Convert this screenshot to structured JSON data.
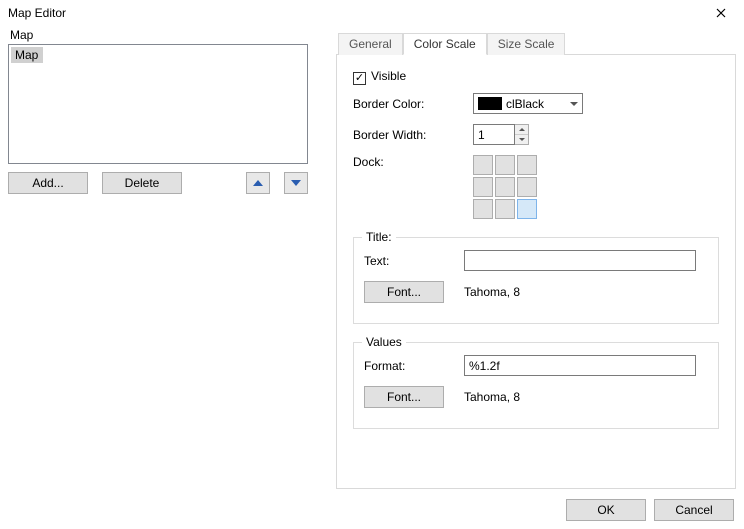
{
  "window": {
    "title": "Map Editor"
  },
  "left": {
    "group_label": "Map",
    "list": {
      "item0": "Map"
    },
    "add_label": "Add...",
    "delete_label": "Delete"
  },
  "tabs": {
    "general": "General",
    "color_scale": "Color Scale",
    "size_scale": "Size Scale"
  },
  "panel": {
    "visible_label": "Visible",
    "visible_checked": true,
    "border_color_label": "Border Color:",
    "border_color_value": "clBlack",
    "border_width_label": "Border Width:",
    "border_width_value": "1",
    "dock_label": "Dock:",
    "dock_selected_index": 8
  },
  "title_group": {
    "legend": "Title:",
    "text_label": "Text:",
    "text_value": "",
    "font_btn": "Font...",
    "font_value": "Tahoma, 8"
  },
  "values_group": {
    "legend": "Values",
    "format_label": "Format:",
    "format_value": "%1.2f",
    "font_btn": "Font...",
    "font_value": "Tahoma, 8"
  },
  "footer": {
    "ok": "OK",
    "cancel": "Cancel"
  }
}
